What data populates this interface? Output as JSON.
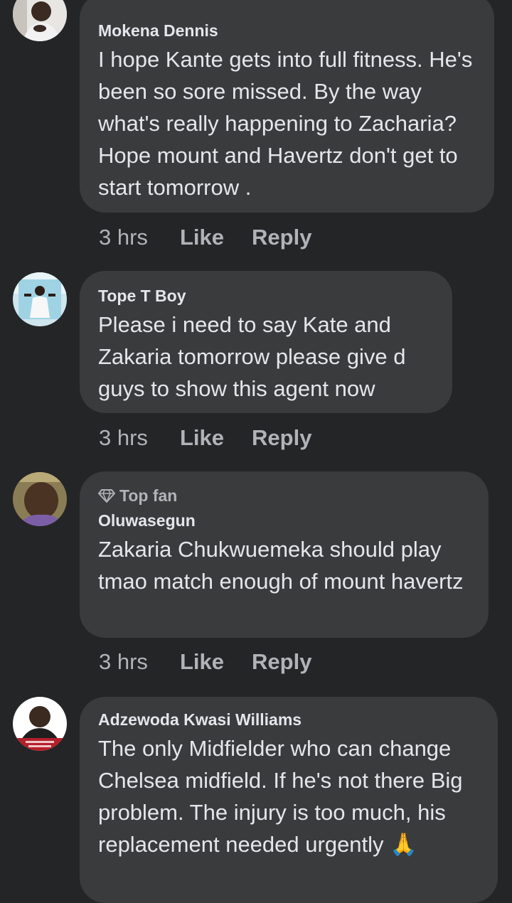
{
  "comments": [
    {
      "author": "Mokena Dennis",
      "badge": "",
      "text": "I hope Kante gets into full fitness. He's been so sore missed. By the way what's really happening to Zacharia? Hope mount and Havertz don't get to start tomorrow .",
      "time": "3 hrs",
      "like_label": "Like",
      "reply_label": "Reply"
    },
    {
      "author": "Tope T Boy",
      "badge": "",
      "text": "Please i need to say Kate and Zakaria tomorrow please give d guys to show this agent now",
      "time": "3 hrs",
      "like_label": "Like",
      "reply_label": "Reply"
    },
    {
      "author": "Oluwasegun",
      "badge": "Top fan",
      "text": "Zakaria Chukwuemeka should play tmao match enough of mount havertz",
      "time": "3 hrs",
      "like_label": "Like",
      "reply_label": "Reply"
    },
    {
      "author": "Adzewoda Kwasi Williams",
      "badge": "",
      "text": "The only Midfielder who can change Chelsea midfield. If he's not there Big problem. The injury is too much, his replacement needed urgently 🙏",
      "time": "",
      "like_label": "",
      "reply_label": ""
    }
  ],
  "icons": {
    "top_fan": "diamond-icon"
  },
  "colors": {
    "background": "#242526",
    "bubble": "#3a3b3c",
    "primary_text": "#e4e6eb",
    "secondary_text": "#b0b3b8"
  }
}
